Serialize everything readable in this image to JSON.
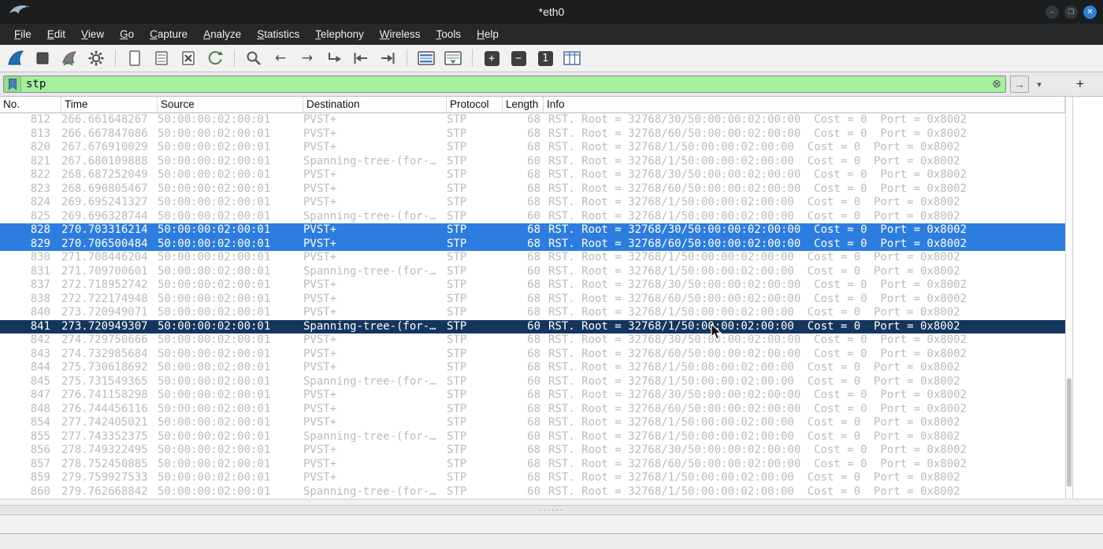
{
  "window": {
    "title": "*eth0"
  },
  "window_controls": {
    "minimize": "–",
    "maximize": "❐",
    "close": "✕"
  },
  "menu": {
    "items": [
      "File",
      "Edit",
      "View",
      "Go",
      "Capture",
      "Analyze",
      "Statistics",
      "Telephony",
      "Wireless",
      "Tools",
      "Help"
    ]
  },
  "toolbar": {
    "icons": [
      "start-capture",
      "stop-capture",
      "restart-capture",
      "capture-options",
      "open-file",
      "save-file",
      "close-file",
      "reload-file",
      "find-packet",
      "go-back",
      "go-forward",
      "go-to-packet",
      "go-first-packet",
      "go-last-packet",
      "colorize-packets",
      "auto-scroll",
      "zoom-in",
      "zoom-out",
      "zoom-reset",
      "resize-columns"
    ],
    "back_glyph": "←",
    "forward_glyph": "→",
    "zoom_in_label": "+",
    "zoom_out_label": "−",
    "zoom_reset_label": "1"
  },
  "filter": {
    "value": "stp",
    "clear_glyph": "⊗",
    "apply_glyph": "→",
    "dropdown_glyph": "▾",
    "add_label": "+"
  },
  "splitter_dots": "······",
  "packet_table": {
    "columns": [
      "No.",
      "Time",
      "Source",
      "Destination",
      "Protocol",
      "Length",
      "Info"
    ],
    "rows": [
      {
        "no": "812",
        "time": "266.661648267",
        "source": "50:00:00:02:00:01",
        "destination": "PVST+",
        "protocol": "STP",
        "length": "68",
        "info": "RST. Root = 32768/30/50:00:00:02:00:00  Cost = 0  Port = 0x8002",
        "state": "normal"
      },
      {
        "no": "813",
        "time": "266.667847086",
        "source": "50:00:00:02:00:01",
        "destination": "PVST+",
        "protocol": "STP",
        "length": "68",
        "info": "RST. Root = 32768/60/50:00:00:02:00:00  Cost = 0  Port = 0x8002",
        "state": "normal"
      },
      {
        "no": "820",
        "time": "267.676910029",
        "source": "50:00:00:02:00:01",
        "destination": "PVST+",
        "protocol": "STP",
        "length": "68",
        "info": "RST. Root = 32768/1/50:00:00:02:00:00  Cost = 0  Port = 0x8002",
        "state": "normal"
      },
      {
        "no": "821",
        "time": "267.680109888",
        "source": "50:00:00:02:00:01",
        "destination": "Spanning-tree-(for-…",
        "protocol": "STP",
        "length": "60",
        "info": "RST. Root = 32768/1/50:00:00:02:00:00  Cost = 0  Port = 0x8002",
        "state": "normal"
      },
      {
        "no": "822",
        "time": "268.687252049",
        "source": "50:00:00:02:00:01",
        "destination": "PVST+",
        "protocol": "STP",
        "length": "68",
        "info": "RST. Root = 32768/30/50:00:00:02:00:00  Cost = 0  Port = 0x8002",
        "state": "normal"
      },
      {
        "no": "823",
        "time": "268.690805467",
        "source": "50:00:00:02:00:01",
        "destination": "PVST+",
        "protocol": "STP",
        "length": "68",
        "info": "RST. Root = 32768/60/50:00:00:02:00:00  Cost = 0  Port = 0x8002",
        "state": "normal"
      },
      {
        "no": "824",
        "time": "269.695241327",
        "source": "50:00:00:02:00:01",
        "destination": "PVST+",
        "protocol": "STP",
        "length": "68",
        "info": "RST. Root = 32768/1/50:00:00:02:00:00  Cost = 0  Port = 0x8002",
        "state": "normal"
      },
      {
        "no": "825",
        "time": "269.696328744",
        "source": "50:00:00:02:00:01",
        "destination": "Spanning-tree-(for-…",
        "protocol": "STP",
        "length": "60",
        "info": "RST. Root = 32768/1/50:00:00:02:00:00  Cost = 0  Port = 0x8002",
        "state": "normal"
      },
      {
        "no": "828",
        "time": "270.703316214",
        "source": "50:00:00:02:00:01",
        "destination": "PVST+",
        "protocol": "STP",
        "length": "68",
        "info": "RST. Root = 32768/30/50:00:00:02:00:00  Cost = 0  Port = 0x8002",
        "state": "highlight"
      },
      {
        "no": "829",
        "time": "270.706500484",
        "source": "50:00:00:02:00:01",
        "destination": "PVST+",
        "protocol": "STP",
        "length": "68",
        "info": "RST. Root = 32768/60/50:00:00:02:00:00  Cost = 0  Port = 0x8002",
        "state": "highlight"
      },
      {
        "no": "830",
        "time": "271.708446204",
        "source": "50:00:00:02:00:01",
        "destination": "PVST+",
        "protocol": "STP",
        "length": "68",
        "info": "RST. Root = 32768/1/50:00:00:02:00:00  Cost = 0  Port = 0x8002",
        "state": "normal"
      },
      {
        "no": "831",
        "time": "271.709700601",
        "source": "50:00:00:02:00:01",
        "destination": "Spanning-tree-(for-…",
        "protocol": "STP",
        "length": "60",
        "info": "RST. Root = 32768/1/50:00:00:02:00:00  Cost = 0  Port = 0x8002",
        "state": "normal"
      },
      {
        "no": "837",
        "time": "272.718952742",
        "source": "50:00:00:02:00:01",
        "destination": "PVST+",
        "protocol": "STP",
        "length": "68",
        "info": "RST. Root = 32768/30/50:00:00:02:00:00  Cost = 0  Port = 0x8002",
        "state": "normal"
      },
      {
        "no": "838",
        "time": "272.722174948",
        "source": "50:00:00:02:00:01",
        "destination": "PVST+",
        "protocol": "STP",
        "length": "68",
        "info": "RST. Root = 32768/60/50:00:00:02:00:00  Cost = 0  Port = 0x8002",
        "state": "normal"
      },
      {
        "no": "840",
        "time": "273.720949071",
        "source": "50:00:00:02:00:01",
        "destination": "PVST+",
        "protocol": "STP",
        "length": "68",
        "info": "RST. Root = 32768/1/50:00:00:02:00:00  Cost = 0  Port = 0x8002",
        "state": "normal"
      },
      {
        "no": "841",
        "time": "273.720949307",
        "source": "50:00:00:02:00:01",
        "destination": "Spanning-tree-(for-…",
        "protocol": "STP",
        "length": "60",
        "info": "RST. Root = 32768/1/50:00:00:02:00:00  Cost = 0  Port = 0x8002",
        "state": "selected"
      },
      {
        "no": "842",
        "time": "274.729750666",
        "source": "50:00:00:02:00:01",
        "destination": "PVST+",
        "protocol": "STP",
        "length": "68",
        "info": "RST. Root = 32768/30/50:00:00:02:00:00  Cost = 0  Port = 0x8002",
        "state": "normal"
      },
      {
        "no": "843",
        "time": "274.732985684",
        "source": "50:00:00:02:00:01",
        "destination": "PVST+",
        "protocol": "STP",
        "length": "68",
        "info": "RST. Root = 32768/60/50:00:00:02:00:00  Cost = 0  Port = 0x8002",
        "state": "normal"
      },
      {
        "no": "844",
        "time": "275.730618692",
        "source": "50:00:00:02:00:01",
        "destination": "PVST+",
        "protocol": "STP",
        "length": "68",
        "info": "RST. Root = 32768/1/50:00:00:02:00:00  Cost = 0  Port = 0x8002",
        "state": "normal"
      },
      {
        "no": "845",
        "time": "275.731549365",
        "source": "50:00:00:02:00:01",
        "destination": "Spanning-tree-(for-…",
        "protocol": "STP",
        "length": "60",
        "info": "RST. Root = 32768/1/50:00:00:02:00:00  Cost = 0  Port = 0x8002",
        "state": "normal"
      },
      {
        "no": "847",
        "time": "276.741158298",
        "source": "50:00:00:02:00:01",
        "destination": "PVST+",
        "protocol": "STP",
        "length": "68",
        "info": "RST. Root = 32768/30/50:00:00:02:00:00  Cost = 0  Port = 0x8002",
        "state": "normal"
      },
      {
        "no": "848",
        "time": "276.744456116",
        "source": "50:00:00:02:00:01",
        "destination": "PVST+",
        "protocol": "STP",
        "length": "68",
        "info": "RST. Root = 32768/60/50:00:00:02:00:00  Cost = 0  Port = 0x8002",
        "state": "normal"
      },
      {
        "no": "854",
        "time": "277.742405021",
        "source": "50:00:00:02:00:01",
        "destination": "PVST+",
        "protocol": "STP",
        "length": "68",
        "info": "RST. Root = 32768/1/50:00:00:02:00:00  Cost = 0  Port = 0x8002",
        "state": "normal"
      },
      {
        "no": "855",
        "time": "277.743352375",
        "source": "50:00:00:02:00:01",
        "destination": "Spanning-tree-(for-…",
        "protocol": "STP",
        "length": "60",
        "info": "RST. Root = 32768/1/50:00:00:02:00:00  Cost = 0  Port = 0x8002",
        "state": "normal"
      },
      {
        "no": "856",
        "time": "278.749322495",
        "source": "50:00:00:02:00:01",
        "destination": "PVST+",
        "protocol": "STP",
        "length": "68",
        "info": "RST. Root = 32768/30/50:00:00:02:00:00  Cost = 0  Port = 0x8002",
        "state": "normal"
      },
      {
        "no": "857",
        "time": "278.752450885",
        "source": "50:00:00:02:00:01",
        "destination": "PVST+",
        "protocol": "STP",
        "length": "68",
        "info": "RST. Root = 32768/60/50:00:00:02:00:00  Cost = 0  Port = 0x8002",
        "state": "normal"
      },
      {
        "no": "859",
        "time": "279.759927533",
        "source": "50:00:00:02:00:01",
        "destination": "PVST+",
        "protocol": "STP",
        "length": "68",
        "info": "RST. Root = 32768/1/50:00:00:02:00:00  Cost = 0  Port = 0x8002",
        "state": "normal"
      },
      {
        "no": "860",
        "time": "279.762668842",
        "source": "50:00:00:02:00:01",
        "destination": "Spanning-tree-(for-…",
        "protocol": "STP",
        "length": "60",
        "info": "RST. Root = 32768/1/50:00:00:02:00:00  Cost = 0  Port = 0x8002",
        "state": "normal"
      }
    ]
  }
}
